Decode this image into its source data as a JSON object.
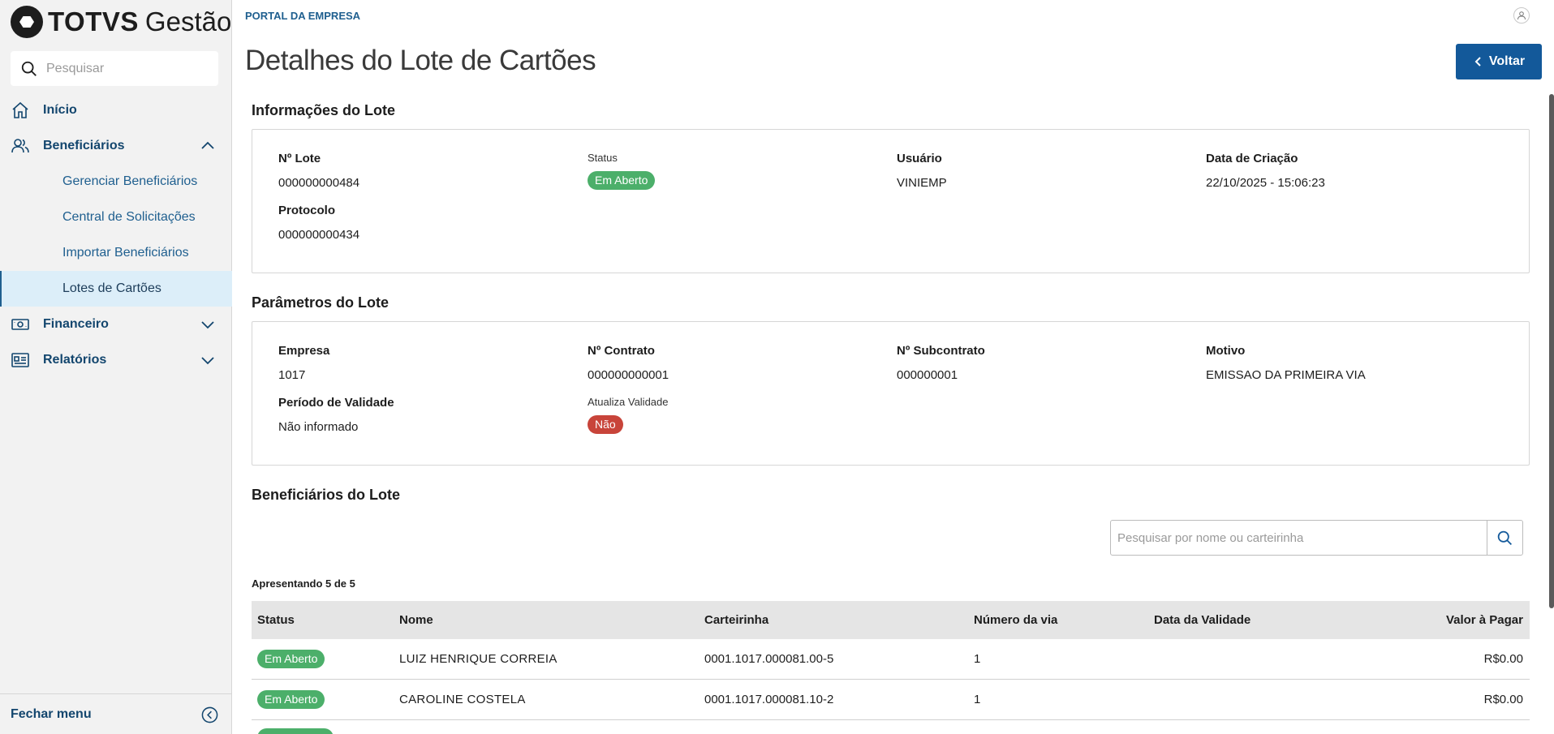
{
  "brand": {
    "name_bold": "TOTVS",
    "name_light": "Gestão"
  },
  "sidebar": {
    "search_placeholder": "Pesquisar",
    "items": [
      {
        "label": "Início",
        "icon": "home-icon"
      },
      {
        "label": "Beneficiários",
        "icon": "users-icon",
        "expanded": true,
        "children": [
          {
            "label": "Gerenciar Beneficiários"
          },
          {
            "label": "Central de Solicitações"
          },
          {
            "label": "Importar Beneficiários"
          },
          {
            "label": "Lotes de Cartões",
            "active": true
          }
        ]
      },
      {
        "label": "Financeiro",
        "icon": "money-icon"
      },
      {
        "label": "Relatórios",
        "icon": "report-icon"
      }
    ],
    "close_label": "Fechar menu"
  },
  "header": {
    "breadcrumb": "PORTAL DA EMPRESA",
    "title": "Detalhes do Lote de Cartões",
    "back_label": "Voltar"
  },
  "lote_info": {
    "section_title": "Informações do Lote",
    "numero_label": "Nº Lote",
    "numero_value": "000000000484",
    "status_label": "Status",
    "status_value": "Em Aberto",
    "usuario_label": "Usuário",
    "usuario_value": "VINIEMP",
    "data_label": "Data de Criação",
    "data_value": "22/10/2025 - 15:06:23",
    "protocolo_label": "Protocolo",
    "protocolo_value": "000000000434"
  },
  "parametros": {
    "section_title": "Parâmetros do Lote",
    "empresa_label": "Empresa",
    "empresa_value": "1017",
    "contrato_label": "Nº Contrato",
    "contrato_value": "000000000001",
    "subcontrato_label": "Nº Subcontrato",
    "subcontrato_value": "000000001",
    "motivo_label": "Motivo",
    "motivo_value": "EMISSAO DA PRIMEIRA VIA",
    "periodo_label": "Período de Validade",
    "periodo_value": "Não informado",
    "atualiza_label": "Atualiza Validade",
    "atualiza_value": "Não"
  },
  "beneficiarios": {
    "section_title": "Beneficiários do Lote",
    "search_placeholder": "Pesquisar por nome ou carteirinha",
    "showing": "Apresentando 5 de 5",
    "columns": [
      "Status",
      "Nome",
      "Carteirinha",
      "Número da via",
      "Data da Validade",
      "Valor à Pagar"
    ],
    "rows": [
      {
        "status": "Em Aberto",
        "nome": "LUIZ HENRIQUE CORREIA",
        "carteirinha": "0001.1017.000081.00-5",
        "via": "1",
        "validade": "",
        "valor": "R$0.00"
      },
      {
        "status": "Em Aberto",
        "nome": "CAROLINE COSTELA",
        "carteirinha": "0001.1017.000081.10-2",
        "via": "1",
        "validade": "",
        "valor": "R$0.00"
      }
    ]
  },
  "colors": {
    "primary": "#13599a",
    "nav_text": "#13466e",
    "badge_open": "#4caf6a",
    "badge_no": "#c8443a"
  }
}
